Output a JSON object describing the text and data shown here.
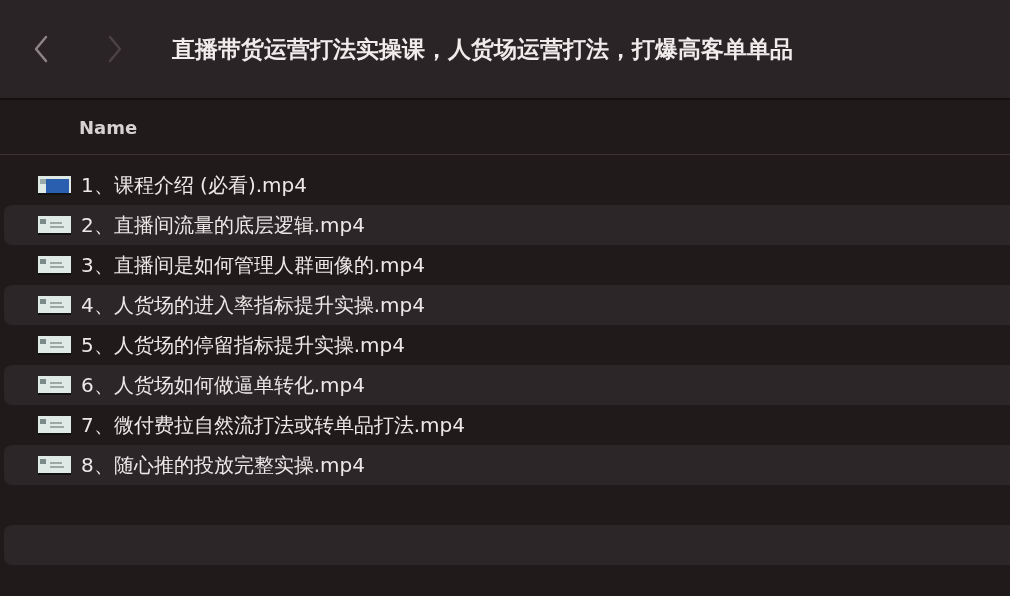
{
  "window": {
    "title": "直播带货运营打法实操课，人货场运营打法，打爆高客单单品"
  },
  "nav": {
    "back_disabled": false,
    "forward_disabled": true
  },
  "table": {
    "columns": [
      "Name"
    ],
    "rows": [
      {
        "name": "1、课程介绍 (必看).mp4",
        "kind": "blue"
      },
      {
        "name": "2、直播间流量的底层逻辑.mp4",
        "kind": "light"
      },
      {
        "name": "3、直播间是如何管理人群画像的.mp4",
        "kind": "light"
      },
      {
        "name": "4、人货场的进入率指标提升实操.mp4",
        "kind": "light"
      },
      {
        "name": "5、人货场的停留指标提升实操.mp4",
        "kind": "light"
      },
      {
        "name": "6、人货场如何做逼单转化.mp4",
        "kind": "light"
      },
      {
        "name": "7、微付费拉自然流打法或转单品打法.mp4",
        "kind": "light"
      },
      {
        "name": "8、随心推的投放完整实操.mp4",
        "kind": "light"
      }
    ]
  }
}
